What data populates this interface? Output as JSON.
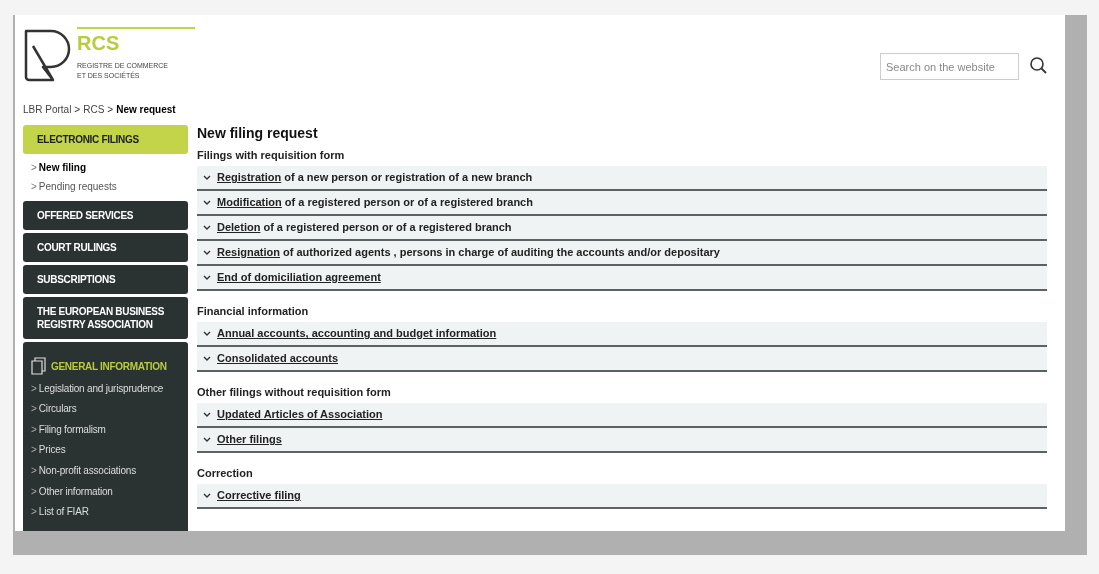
{
  "logo": {
    "title": "RCS",
    "subtitle_lines": [
      "REGISTRE DE COMMERCE",
      "ET DES SOCIÉTÉS"
    ]
  },
  "search": {
    "placeholder": "Search on the website"
  },
  "breadcrumb": [
    {
      "label": "LBR Portal",
      "current": false
    },
    {
      "label": "RCS",
      "current": false
    },
    {
      "label": "New request",
      "current": true
    }
  ],
  "breadcrumb_separator": ">",
  "sidebar": [
    {
      "kind": "section",
      "label": "ELECTRONIC FILINGS",
      "selected": true,
      "children": [
        {
          "label": "New filing",
          "selected": true
        },
        {
          "label": "Pending requests",
          "selected": false
        }
      ]
    },
    {
      "kind": "section",
      "label": "OFFERED SERVICES",
      "selected": false
    },
    {
      "kind": "section",
      "label": "COURT RULINGS",
      "selected": false
    },
    {
      "kind": "section",
      "label": "SUBSCRIPTIONS",
      "selected": false
    },
    {
      "kind": "section",
      "label": "THE EUROPEAN BUSINESS REGISTRY ASSOCIATION",
      "selected": false
    },
    {
      "kind": "panel",
      "label": "GENERAL INFORMATION",
      "children": [
        {
          "label": "Legislation and jurisprudence"
        },
        {
          "label": "Circulars"
        },
        {
          "label": "Filing formalism"
        },
        {
          "label": "Prices"
        },
        {
          "label": "Non-profit associations"
        },
        {
          "label": "Other information"
        },
        {
          "label": "List of FIAR"
        }
      ]
    }
  ],
  "link_marker": ">",
  "main": {
    "title": "New filing request",
    "groups": [
      {
        "heading": "Filings with requisition form",
        "items": [
          {
            "link": "Registration",
            "rest": "of a new person or registration of a new branch"
          },
          {
            "link": "Modification",
            "rest": "of a registered person or of a registered branch"
          },
          {
            "link": "Deletion",
            "rest": "of a registered person or of a registered branch"
          },
          {
            "link": "Resignation",
            "rest": "of authorized agents , persons in charge of auditing the accounts and/or depositary"
          },
          {
            "link": "End of domiciliation agreement"
          }
        ]
      },
      {
        "heading": "Financial information",
        "items": [
          {
            "link": "Annual accounts, accounting and budget information"
          },
          {
            "link": "Consolidated accounts"
          }
        ]
      },
      {
        "heading": "Other filings without requisition form",
        "items": [
          {
            "link": "Updated Articles of Association"
          },
          {
            "link": "Other filings"
          }
        ]
      },
      {
        "heading": "Correction",
        "items": [
          {
            "link": "Corrective filing"
          }
        ]
      }
    ]
  }
}
